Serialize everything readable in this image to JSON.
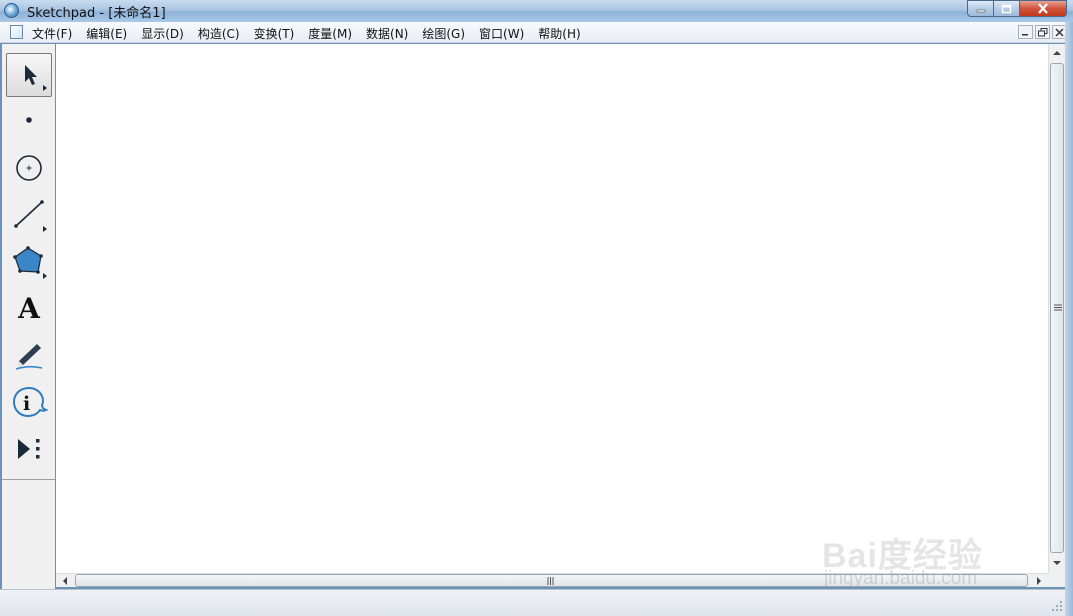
{
  "window": {
    "title": "Sketchpad  - [未命名1]",
    "controls": {
      "minimize": "minimize",
      "maximize": "maximize",
      "close": "close"
    }
  },
  "menubar": {
    "items": [
      {
        "label": "文件(F)"
      },
      {
        "label": "编辑(E)"
      },
      {
        "label": "显示(D)"
      },
      {
        "label": "构造(C)"
      },
      {
        "label": "变换(T)"
      },
      {
        "label": "度量(M)"
      },
      {
        "label": "数据(N)"
      },
      {
        "label": "绘图(G)"
      },
      {
        "label": "窗口(W)"
      },
      {
        "label": "帮助(H)"
      }
    ]
  },
  "toolbox": {
    "tools": [
      {
        "icon": "arrow-select-icon",
        "selected": true
      },
      {
        "icon": "point-icon"
      },
      {
        "icon": "compass-icon"
      },
      {
        "icon": "straightedge-icon"
      },
      {
        "icon": "polygon-icon"
      },
      {
        "icon": "text-icon",
        "glyph": "A"
      },
      {
        "icon": "marker-icon"
      },
      {
        "icon": "information-icon",
        "glyph": "i"
      },
      {
        "icon": "custom-tool-icon"
      }
    ]
  },
  "watermark": {
    "brand": "Bai度经验",
    "url": "jingyan.baidu.com"
  },
  "colors": {
    "title_bar": "#a9c5e2",
    "close_button": "#c0391f",
    "canvas": "#ffffff",
    "toolbox": "#f0f0f0",
    "polygon_fill": "#3a86c8"
  }
}
